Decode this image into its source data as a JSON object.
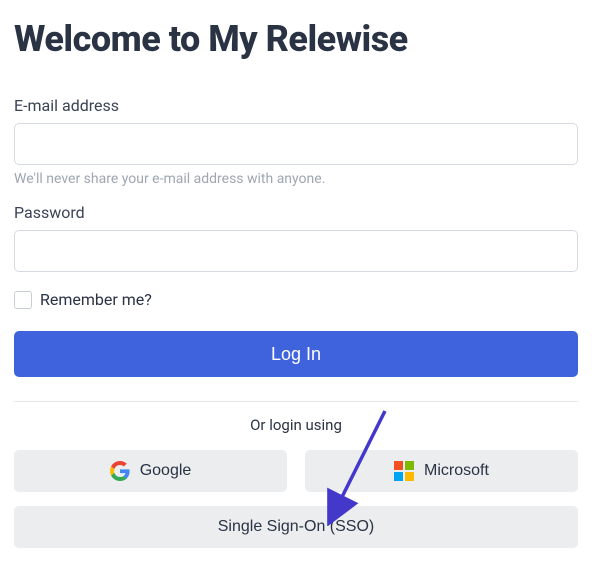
{
  "title": "Welcome to My Relewise",
  "email": {
    "label": "E-mail address",
    "value": "",
    "help": "We'll never share your e-mail address with anyone."
  },
  "password": {
    "label": "Password",
    "value": ""
  },
  "remember": {
    "label": "Remember me?",
    "checked": false
  },
  "login_button": "Log In",
  "divider_text": "Or login using",
  "providers": {
    "google": "Google",
    "microsoft": "Microsoft"
  },
  "sso_button": "Single Sign-On (SSO)",
  "colors": {
    "primary": "#3e63dd",
    "text": "#2a3344",
    "muted": "#9ea6b2",
    "secondary_bg": "#ebedef",
    "arrow": "#4338ca"
  }
}
